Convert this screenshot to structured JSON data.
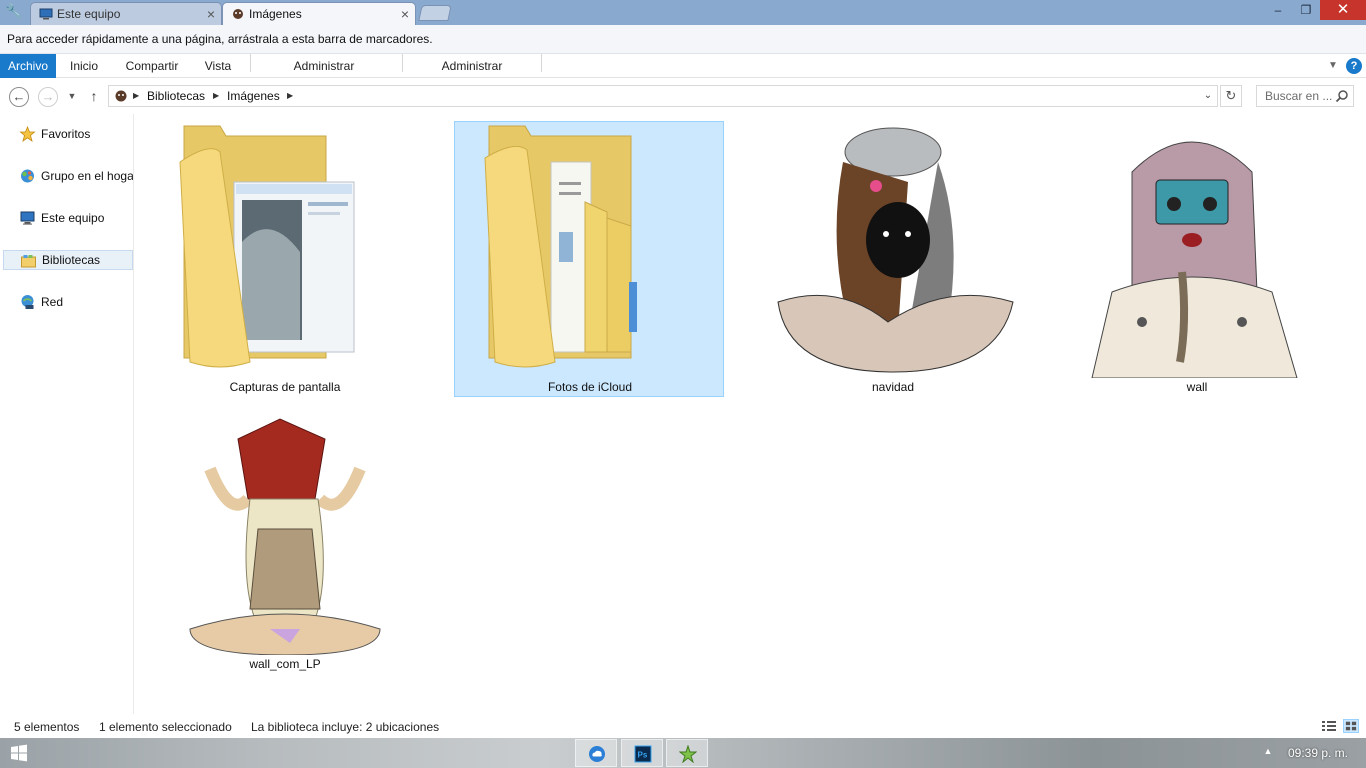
{
  "browser": {
    "tabs": [
      {
        "label": "Este equipo",
        "active": false
      },
      {
        "label": "Imágenes",
        "active": true
      }
    ],
    "bookmarks_hint": "Para acceder rápidamente a una página, arrástrala a esta barra de marcadores."
  },
  "ribbon": {
    "tabs": [
      "Archivo",
      "Inicio",
      "Compartir",
      "Vista",
      "Administrar",
      "Administrar"
    ],
    "help": "?"
  },
  "address": {
    "crumbs": [
      "Bibliotecas",
      "Imágenes"
    ],
    "search_placeholder": "Buscar en ..."
  },
  "navigation": {
    "items": [
      {
        "label": "Favoritos",
        "icon": "star-icon"
      },
      {
        "label": "Grupo en el hoga",
        "icon": "homegroup-icon"
      },
      {
        "label": "Este equipo",
        "icon": "computer-icon"
      },
      {
        "label": "Bibliotecas",
        "icon": "libraries-icon",
        "selected": true
      },
      {
        "label": "Red",
        "icon": "network-icon"
      }
    ]
  },
  "items": [
    {
      "name": "Capturas de pantalla",
      "kind": "folder"
    },
    {
      "name": "Fotos de iCloud",
      "kind": "folder",
      "selected": true
    },
    {
      "name": "navidad",
      "kind": "image"
    },
    {
      "name": "wall",
      "kind": "image"
    },
    {
      "name": "wall_com_LP",
      "kind": "image"
    }
  ],
  "status": {
    "count": "5 elementos",
    "selection": "1 elemento seleccionado",
    "library": "La biblioteca incluye: 2 ubicaciones"
  },
  "taskbar": {
    "clock": "09:39 p. m.",
    "apps": [
      "icloud-icon",
      "photoshop-icon",
      "app-icon"
    ],
    "ps_label": "Ps"
  },
  "colors": {
    "accent": "#1979ca",
    "selection": "#cce8ff",
    "selection_border": "#99d1ff",
    "close_button": "#c7342b"
  }
}
